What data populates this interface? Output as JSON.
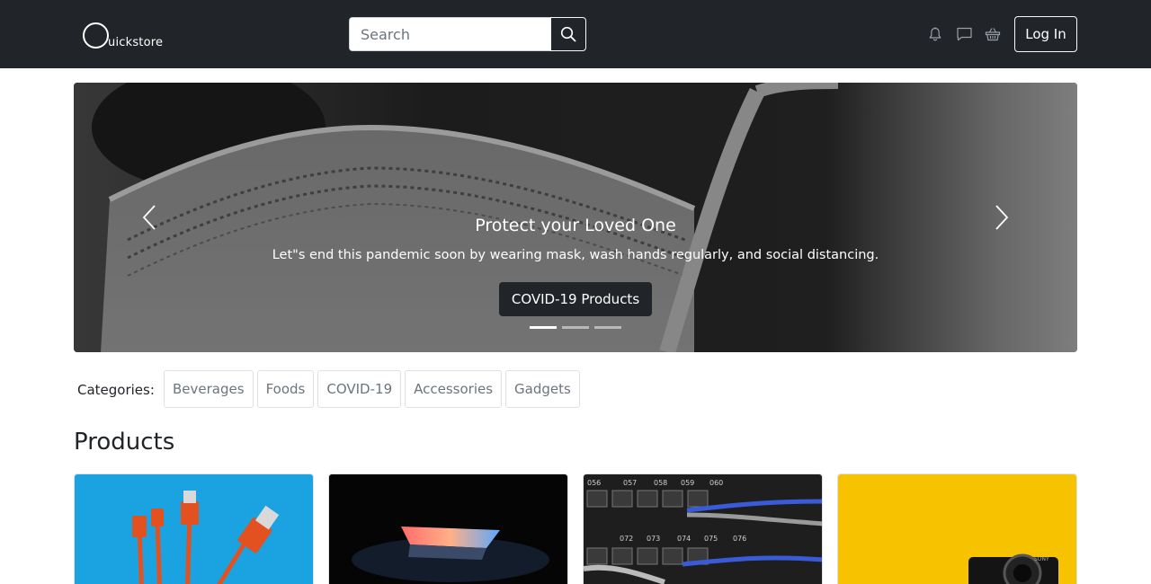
{
  "brand": {
    "letter": "Q",
    "text": "uickstore"
  },
  "search": {
    "placeholder": "Search",
    "value": ""
  },
  "nav": {
    "icons": [
      "bell-icon",
      "chat-icon",
      "basket-icon"
    ],
    "login_label": "Log In"
  },
  "carousel": {
    "title": "Protect your Loved One",
    "text": "Let\"s end this pandemic soon by wearing mask, wash hands regularly, and social distancing.",
    "cta_label": "COVID-19 Products",
    "slides_count": 3,
    "active_slide": 1
  },
  "categories": {
    "label": "Categories:",
    "items": [
      "Beverages",
      "Foods",
      "COVID-19",
      "Accessories",
      "Gadgets"
    ]
  },
  "products": {
    "heading": "Products",
    "cards": [
      {
        "image": "usb-cables-image"
      },
      {
        "image": "laptop-image"
      },
      {
        "image": "network-switch-image"
      },
      {
        "image": "camera-image"
      }
    ]
  },
  "colors": {
    "navbar": "#212529",
    "text": "#212529",
    "muted": "#6c757d",
    "border": "#dee2e6"
  }
}
